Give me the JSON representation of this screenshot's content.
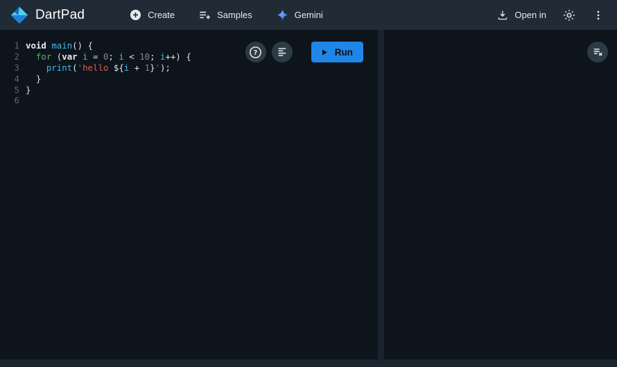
{
  "app": {
    "title": "DartPad"
  },
  "appbar": {
    "menus": [
      {
        "label": "Create",
        "icon": "add-circle-icon"
      },
      {
        "label": "Samples",
        "icon": "playlist-add-icon"
      },
      {
        "label": "Gemini",
        "icon": "gemini-sparkle-icon"
      }
    ],
    "open_in_label": "Open in",
    "right_icons": [
      "download-icon",
      "brightness-icon",
      "kebab-menu-icon"
    ]
  },
  "editor": {
    "run_label": "Run",
    "action_icons": [
      "help-icon",
      "format-icon",
      "play-icon"
    ],
    "lines": [
      {
        "n": "1",
        "tokens": [
          {
            "t": "void",
            "c": "kw"
          },
          {
            "t": " ",
            "c": "pl"
          },
          {
            "t": "main",
            "c": "fn"
          },
          {
            "t": "() {",
            "c": "pl"
          }
        ]
      },
      {
        "n": "2",
        "tokens": [
          {
            "t": "  ",
            "c": "pl"
          },
          {
            "t": "for",
            "c": "ctrl"
          },
          {
            "t": " (",
            "c": "pl"
          },
          {
            "t": "var",
            "c": "kw"
          },
          {
            "t": " ",
            "c": "pl"
          },
          {
            "t": "i",
            "c": "fn"
          },
          {
            "t": " = ",
            "c": "pl"
          },
          {
            "t": "0",
            "c": "num"
          },
          {
            "t": "; ",
            "c": "pl"
          },
          {
            "t": "i",
            "c": "fn"
          },
          {
            "t": " < ",
            "c": "pl"
          },
          {
            "t": "10",
            "c": "num"
          },
          {
            "t": "; ",
            "c": "pl"
          },
          {
            "t": "i",
            "c": "fn"
          },
          {
            "t": "++) {",
            "c": "pl"
          }
        ]
      },
      {
        "n": "3",
        "tokens": [
          {
            "t": "    ",
            "c": "pl"
          },
          {
            "t": "print",
            "c": "fn"
          },
          {
            "t": "(",
            "c": "pl"
          },
          {
            "t": "'",
            "c": "q"
          },
          {
            "t": "hello ",
            "c": "str"
          },
          {
            "t": "${",
            "c": "pl"
          },
          {
            "t": "i",
            "c": "fn"
          },
          {
            "t": " + ",
            "c": "pl"
          },
          {
            "t": "1",
            "c": "num"
          },
          {
            "t": "}",
            "c": "pl"
          },
          {
            "t": "'",
            "c": "q"
          },
          {
            "t": ");",
            "c": "pl"
          }
        ]
      },
      {
        "n": "4",
        "tokens": [
          {
            "t": "  }",
            "c": "pl"
          }
        ]
      },
      {
        "n": "5",
        "tokens": [
          {
            "t": "}",
            "c": "pl"
          }
        ]
      },
      {
        "n": "6",
        "tokens": []
      }
    ]
  },
  "console": {
    "action_icons": [
      "clear-console-icon"
    ],
    "content": ""
  },
  "colors": {
    "appbar_bg": "#202b36",
    "panel_bg": "#0d141b",
    "divider": "#19232e",
    "statusbar_bg": "#1b2530",
    "run_button_blue": "#1f86e8",
    "icon_button_bg": "#2d3b46",
    "dart_logo_light_blue": "#50cbf5",
    "dart_logo_blue": "#1c85d8",
    "syntax": {
      "keyword": "#e8edf2",
      "identifier_blue": "#44b8e8",
      "control_green": "#5bb462",
      "number_gray": "#7e8a99",
      "string_red": "#dd5d55",
      "quote_gray": "#6b7685",
      "plain": "#dde3ea",
      "line_number": "#5c6876"
    }
  }
}
